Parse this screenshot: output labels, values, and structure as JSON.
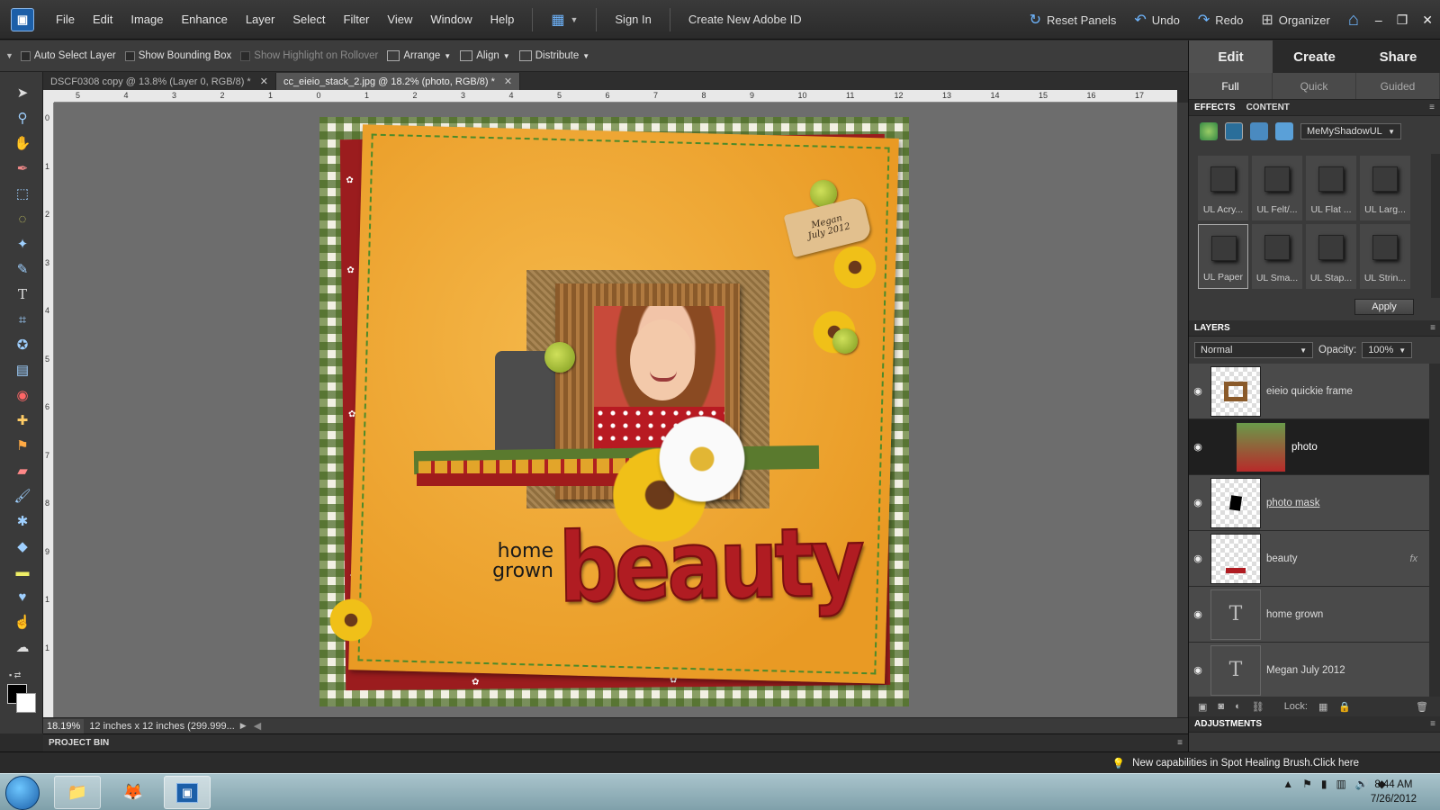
{
  "menubar": {
    "logo": "▣",
    "items": [
      "File",
      "Edit",
      "Image",
      "Enhance",
      "Layer",
      "Select",
      "Filter",
      "View",
      "Window",
      "Help"
    ],
    "sign_in": "Sign In",
    "create_id": "Create New Adobe ID",
    "reset_panels": "Reset Panels",
    "undo": "Undo",
    "redo": "Redo",
    "organizer": "Organizer"
  },
  "options": {
    "auto_select": "Auto Select Layer",
    "show_bounding": "Show Bounding Box",
    "show_highlight": "Show Highlight on Rollover",
    "arrange": "Arrange",
    "align": "Align",
    "distribute": "Distribute"
  },
  "tabs": [
    {
      "label": "DSCF0308 copy @ 13.8% (Layer 0, RGB/8) *",
      "active": false
    },
    {
      "label": "cc_eieio_stack_2.jpg @ 18.2% (photo, RGB/8) *",
      "active": true
    }
  ],
  "ruler_top": [
    "5",
    "4",
    "3",
    "2",
    "1",
    "0",
    "1",
    "2",
    "3",
    "4",
    "5",
    "6",
    "7",
    "8",
    "9",
    "10",
    "11",
    "12",
    "13",
    "14",
    "15",
    "16",
    "17"
  ],
  "ruler_left": [
    "0",
    "1",
    "2",
    "3",
    "4",
    "5",
    "6",
    "7",
    "8",
    "9",
    "1",
    "1"
  ],
  "status": {
    "zoom": "18.19%",
    "doc_size": "12 inches x 12 inches (299.999..."
  },
  "canvas": {
    "tag_line1": "Megan",
    "tag_line2": "July 2012",
    "title_small_1": "home",
    "title_small_2": "grown",
    "title_big": "beauty"
  },
  "modes": {
    "tabs": [
      "Edit",
      "Create",
      "Share"
    ],
    "active": "Edit"
  },
  "edit_modes": {
    "tabs": [
      "Full",
      "Quick",
      "Guided"
    ],
    "active": "Full"
  },
  "effects_panel": {
    "tabs": [
      "EFFECTS",
      "CONTENT"
    ],
    "dropdown": "MeMyShadowUL",
    "items": [
      "UL Acry...",
      "UL Felt/...",
      "UL Flat ...",
      "UL Larg...",
      "UL Paper",
      "UL Sma...",
      "UL Stap...",
      "UL Strin..."
    ],
    "selected": "UL Paper",
    "apply_label": "Apply"
  },
  "layers_panel": {
    "title": "LAYERS",
    "blend_mode": "Normal",
    "opacity_label": "Opacity:",
    "opacity_value": "100%",
    "lock_label": "Lock:",
    "layers": [
      {
        "name": "eieio quickie frame",
        "kind": "image",
        "selected": false
      },
      {
        "name": "photo",
        "kind": "photo",
        "selected": true
      },
      {
        "name": "photo mask",
        "kind": "mask",
        "selected": false
      },
      {
        "name": "beauty",
        "kind": "text-art",
        "selected": false
      },
      {
        "name": "home grown",
        "kind": "text",
        "selected": false
      },
      {
        "name": "Megan July 2012",
        "kind": "text",
        "selected": false
      }
    ]
  },
  "adjustments": {
    "title": "ADJUSTMENTS"
  },
  "project_bin": "PROJECT BIN",
  "tip": "New capabilities in Spot Healing Brush.Click here",
  "taskbar": {
    "time": "8:44 AM",
    "date": "7/26/2012"
  }
}
